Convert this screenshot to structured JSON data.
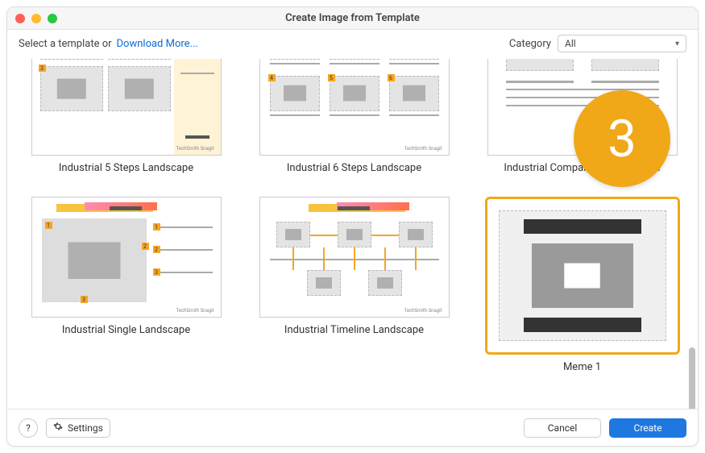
{
  "window": {
    "title": "Create Image from Template"
  },
  "toolbar": {
    "prompt": "Select a template or",
    "download_link": "Download More...",
    "category_label": "Category",
    "category_value": "All"
  },
  "templates": [
    {
      "label": "Industrial 5 Steps Landscape"
    },
    {
      "label": "Industrial 6 Steps Landscape"
    },
    {
      "label": "Industrial Comparison Landscape"
    },
    {
      "label": "Industrial Single Landscape"
    },
    {
      "label": "Industrial Timeline Landscape"
    },
    {
      "label": "Meme 1"
    }
  ],
  "selected_index": 5,
  "step_badge": "3",
  "footer": {
    "help_label": "?",
    "settings_label": "Settings",
    "cancel_label": "Cancel",
    "create_label": "Create"
  },
  "colors": {
    "accent": "#f0a818",
    "primary": "#1f78e0",
    "link": "#0a6cd6"
  }
}
